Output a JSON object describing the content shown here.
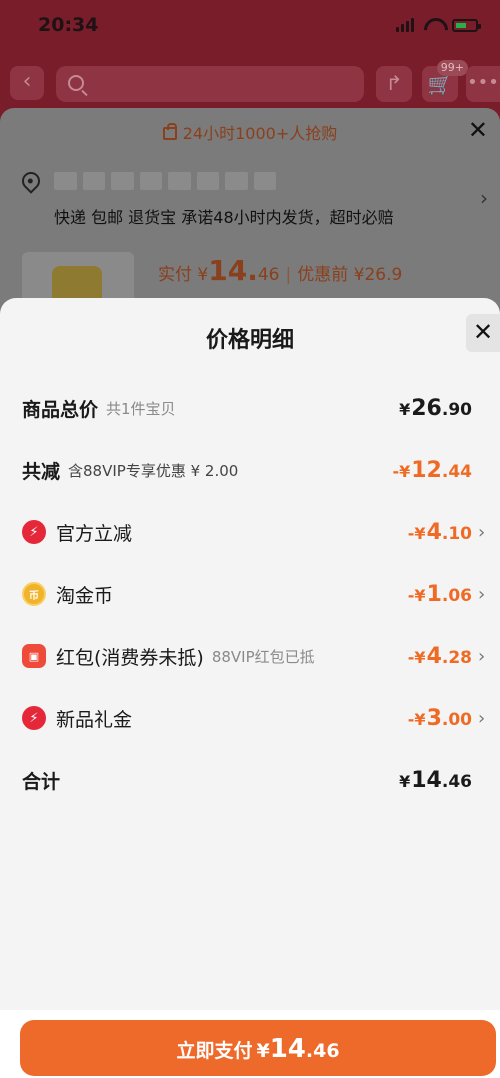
{
  "status_bar": {
    "time": "20:34"
  },
  "nav": {
    "cart_badge": "99+"
  },
  "background_sheet": {
    "promo_text": "24小时1000+人抢购",
    "shipping_text": "快递 包邮 退货宝 承诺48小时内发货，超时必赔",
    "price_prefix": "实付 ¥",
    "price_integer": "14.",
    "price_decimal": "46",
    "separator": "|",
    "original_price": "优惠前 ¥26.9"
  },
  "modal": {
    "title": "价格明细",
    "rows": [
      {
        "label": "商品总价",
        "sub": "共1件宝贝",
        "currency": "¥",
        "integer": "26",
        "decimal": ".90"
      },
      {
        "label": "共减",
        "sub": "含88VIP专享优惠 ¥ 2.00",
        "currency": "-¥",
        "integer": "12",
        "decimal": ".44"
      },
      {
        "label": "官方立减",
        "icon": "lightning-icon",
        "currency": "-¥",
        "integer": "4",
        "decimal": ".10"
      },
      {
        "label": "淘金币",
        "icon": "gold-coin-icon",
        "icon_text": "币",
        "currency": "-¥",
        "integer": "1",
        "decimal": ".06"
      },
      {
        "label": "红包(消费券未抵)",
        "sub": "88VIP红包已抵",
        "icon": "red-packet-icon",
        "currency": "-¥",
        "integer": "4",
        "decimal": ".28"
      },
      {
        "label": "新品礼金",
        "icon": "lightning-icon",
        "currency": "-¥",
        "integer": "3",
        "decimal": ".00"
      },
      {
        "label": "合计",
        "currency": "¥",
        "integer": "14",
        "decimal": ".46"
      }
    ]
  },
  "pay_button": {
    "label": "立即支付",
    "currency": "¥",
    "integer": "14",
    "decimal": ".46"
  },
  "colors": {
    "accent": "#ee6a2b",
    "discount": "#ef6a24",
    "brand_red": "#7a1d2b"
  }
}
